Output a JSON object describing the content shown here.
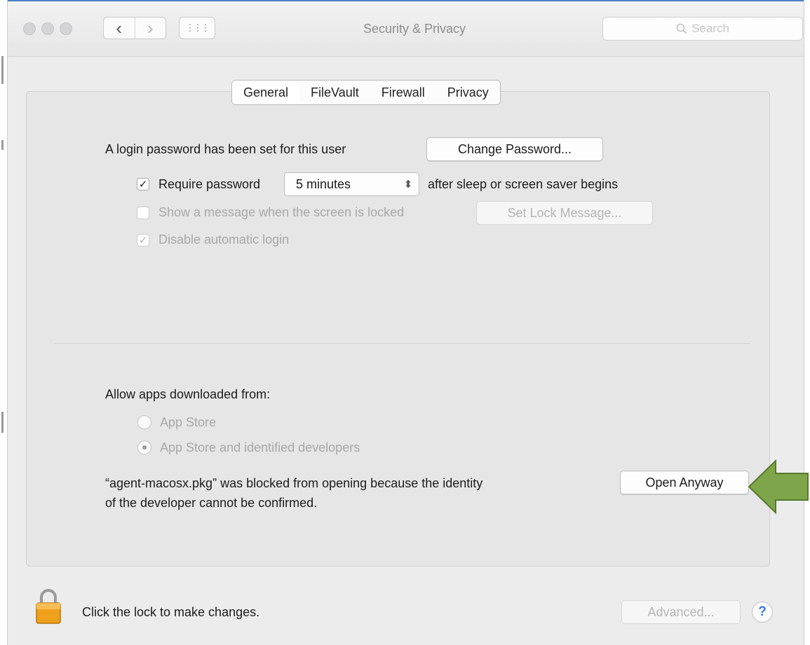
{
  "window": {
    "title": "Security & Privacy",
    "search_placeholder": "Search",
    "nav": {
      "back_glyph": "‹",
      "forward_glyph": "›",
      "grid_glyph": "⋮⋮⋮"
    }
  },
  "tabs": [
    {
      "label": "General",
      "selected": true
    },
    {
      "label": "FileVault",
      "selected": false
    },
    {
      "label": "Firewall",
      "selected": false
    },
    {
      "label": "Privacy",
      "selected": false
    }
  ],
  "general": {
    "password_text": "A login password has been set for this user",
    "change_password_button": "Change Password...",
    "require_password": {
      "checked": true,
      "label": "Require password",
      "value": "5 minutes",
      "suffix": "after sleep or screen saver begins"
    },
    "show_message": {
      "checked": false,
      "enabled": false,
      "label": "Show a message when the screen is locked",
      "button": "Set Lock Message..."
    },
    "disable_login": {
      "checked": true,
      "enabled": false,
      "label": "Disable automatic login"
    }
  },
  "gatekeeper": {
    "heading": "Allow apps downloaded from:",
    "options": [
      {
        "label": "App Store",
        "selected": false
      },
      {
        "label": "App Store and identified developers",
        "selected": true
      }
    ],
    "blocked_line1": "“agent-macosx.pkg” was blocked from opening because the identity",
    "blocked_line2": "of the developer cannot be confirmed.",
    "open_anyway_button": "Open Anyway"
  },
  "footer": {
    "lock_text": "Click the lock to make changes.",
    "advanced_button": "Advanced...",
    "help_glyph": "?"
  },
  "colors": {
    "arrow_fill": "#7fa54a",
    "arrow_stroke": "#557a2c",
    "lock_body": "#f0a11c"
  },
  "icons": [
    "back-icon",
    "forward-icon",
    "grid-icon",
    "search-icon",
    "checkmark-icon",
    "chevron-updown-icon",
    "lock-icon",
    "help-icon",
    "arrow-icon"
  ]
}
